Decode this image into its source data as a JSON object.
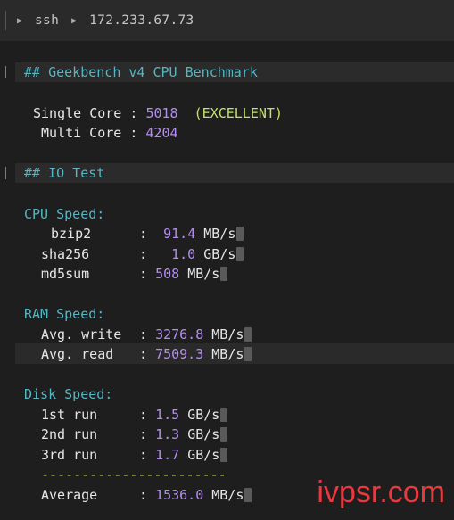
{
  "titlebar": {
    "crumb1": "ssh",
    "crumb2": "172.233.67.73"
  },
  "geekbench": {
    "heading": "## Geekbench v4 CPU Benchmark",
    "single_label": "Single Core",
    "single_value": "5018",
    "single_rating": "(EXCELLENT)",
    "multi_label": "Multi Core",
    "multi_value": "4204"
  },
  "io": {
    "heading": "## IO Test",
    "cpu_title": "CPU Speed:",
    "cpu": [
      {
        "label": "bzip2",
        "value": "91.4",
        "unit": "MB/s"
      },
      {
        "label": "sha256",
        "value": "1.0",
        "unit": "GB/s"
      },
      {
        "label": "md5sum",
        "value": "508",
        "unit": "MB/s"
      }
    ],
    "ram_title": "RAM Speed:",
    "ram": [
      {
        "label": "Avg. write",
        "value": "3276.8",
        "unit": "MB/s"
      },
      {
        "label": "Avg. read",
        "value": "7509.3",
        "unit": "MB/s"
      }
    ],
    "disk_title": "Disk Speed:",
    "disk": [
      {
        "label": "1st run",
        "value": "1.5",
        "unit": "GB/s"
      },
      {
        "label": "2nd run",
        "value": "1.3",
        "unit": "GB/s"
      },
      {
        "label": "3rd run",
        "value": "1.7",
        "unit": "GB/s"
      }
    ],
    "separator": "-----------------------",
    "avg_label": "Average",
    "avg_value": "1536.0",
    "avg_unit": "MB/s"
  },
  "colon": ":",
  "watermark": "ivpsr.com",
  "colors": {
    "background": "#1e1e1e",
    "heading": "#56b6c2",
    "number": "#b48ef0",
    "rating": "#c4e36a",
    "watermark": "#e8393f"
  }
}
